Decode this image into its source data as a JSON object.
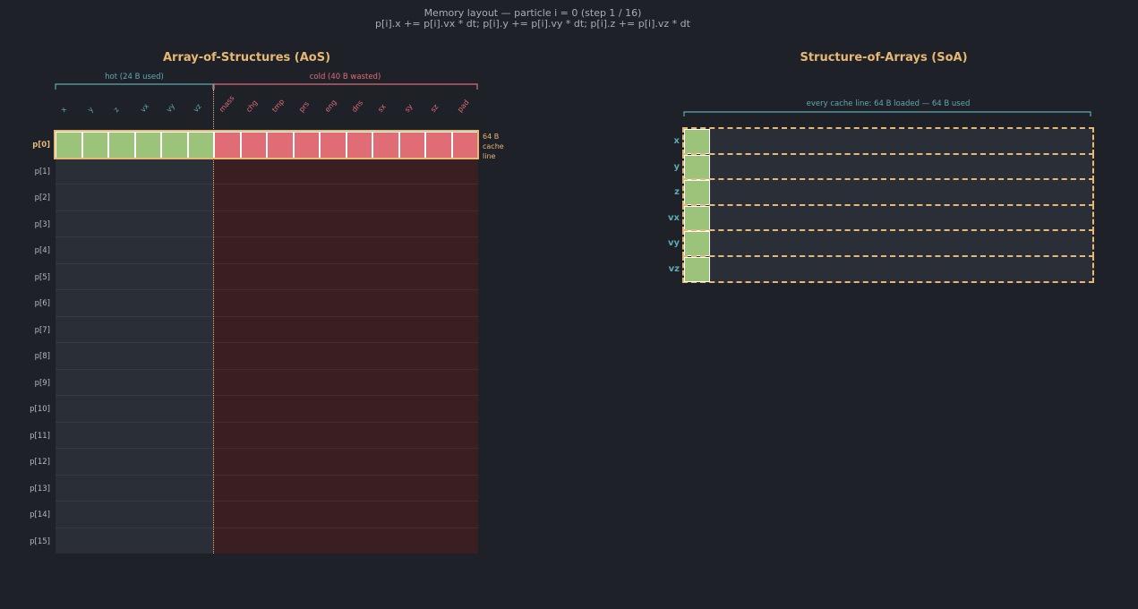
{
  "header": {
    "title": "Memory layout — particle  i = 0  (step 1 / 16)",
    "subtitle": "p[i].x += p[i].vx * dt;   p[i].y += p[i].vy * dt;   p[i].z += p[i].vz * dt"
  },
  "aos": {
    "title": "Array-of-Structures  (AoS)",
    "hot_label": "hot  (24 B used)",
    "cold_label": "cold  (40 B wasted)",
    "cache_note": [
      "64 B",
      "cache",
      "line"
    ],
    "fields": [
      "x",
      "y",
      "z",
      "vx",
      "vy",
      "vz",
      "mass",
      "chg",
      "tmp",
      "prs",
      "eng",
      "dns",
      "sx",
      "sy",
      "sz",
      "pad"
    ],
    "hot_count": 6,
    "rows": [
      "p[0]",
      "p[1]",
      "p[2]",
      "p[3]",
      "p[4]",
      "p[5]",
      "p[6]",
      "p[7]",
      "p[8]",
      "p[9]",
      "p[10]",
      "p[11]",
      "p[12]",
      "p[13]",
      "p[14]",
      "p[15]"
    ],
    "active_row": 0
  },
  "soa": {
    "title": "Structure-of-Arrays  (SoA)",
    "bracket_label": "every cache line: 64 B loaded — 64 B used",
    "rows": [
      "x",
      "y",
      "z",
      "vx",
      "vy",
      "vz"
    ],
    "active_index": 0
  },
  "colors": {
    "hot": "#9bc47a",
    "cold": "#e06c75",
    "highlight": "#e6b873",
    "accent_teal": "#5eaab0",
    "hot_bg": "#2a2e37",
    "cold_bg": "#3a1f22"
  }
}
